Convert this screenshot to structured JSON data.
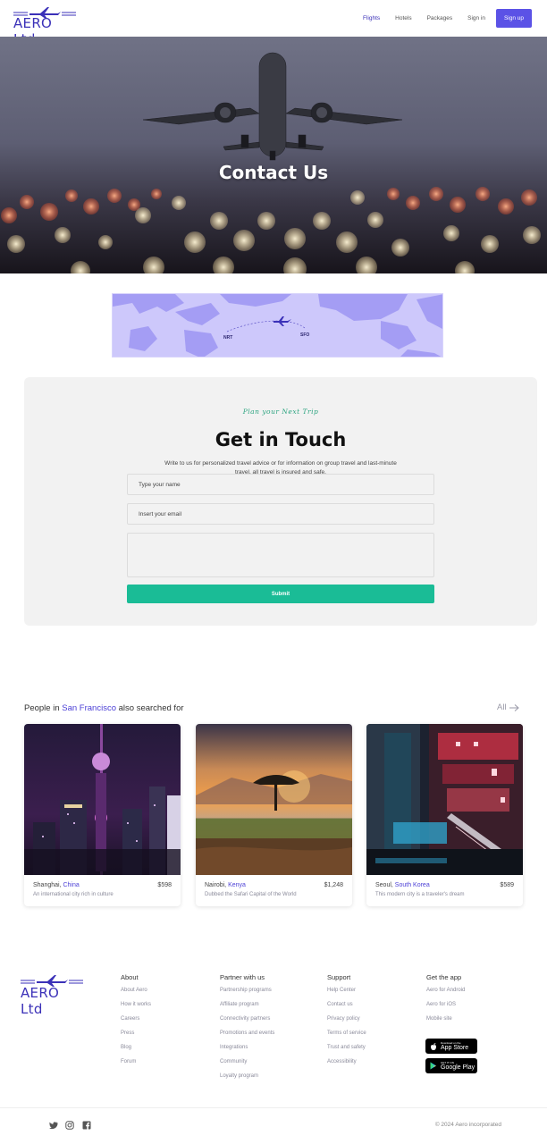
{
  "brand": {
    "name": "AERO Ltd"
  },
  "nav": {
    "links": [
      "Flights",
      "Hotels",
      "Packages",
      "Sign in"
    ],
    "signup": "Sign up",
    "accent": "#5b52e6"
  },
  "hero": {
    "title": "Contact Us"
  },
  "map": {
    "origin": "NRT",
    "destination": "SFO"
  },
  "contact": {
    "script": "Plan your Next Trip",
    "title": "Get in Touch",
    "description": "Write to us for personalized travel advice or for information on group travel and last-minute travel, all travel is insured and safe.",
    "name_placeholder": "Type your name",
    "email_placeholder": "Insert your email",
    "submit": "Submit",
    "submit_color": "#1abc96"
  },
  "searched": {
    "prefix": "People in ",
    "city": "San Francisco",
    "suffix": " also searched for",
    "all_label": "All",
    "cards": [
      {
        "city": "Shanghai, ",
        "country": "China",
        "price": "$598",
        "desc": "An international city rich in culture"
      },
      {
        "city": "Nairobi, ",
        "country": "Kenya",
        "price": "$1,248",
        "desc": "Dubbed the Safari Capital of the World"
      },
      {
        "city": "Seoul, ",
        "country": "South Korea",
        "price": "$589",
        "desc": "This modern city is a traveler's dream"
      }
    ]
  },
  "footer": {
    "columns": [
      {
        "title": "About",
        "items": [
          "About Aero",
          "How it works",
          "Careers",
          "Press",
          "Blog",
          "Forum"
        ]
      },
      {
        "title": "Partner with us",
        "items": [
          "Partnership programs",
          "Affiliate program",
          "Connectivity partners",
          "Promotions and events",
          "Integrations",
          "Community",
          "Loyalty program"
        ]
      },
      {
        "title": "Support",
        "items": [
          "Help Center",
          "Contact us",
          "Privacy policy",
          "Terms of service",
          "Trust and safety",
          "Accessibility"
        ]
      },
      {
        "title": "Get the app",
        "items": [
          "Aero for Android",
          "Aero for iOS",
          "Mobile site"
        ]
      }
    ],
    "appstore": {
      "small": "Download on the",
      "big": "App Store"
    },
    "googleplay": {
      "small": "GET IT ON",
      "big": "Google Play"
    },
    "copyright": "© 2024 Aero incorporated",
    "social_icons": [
      "twitter-icon",
      "instagram-icon",
      "facebook-icon"
    ]
  }
}
